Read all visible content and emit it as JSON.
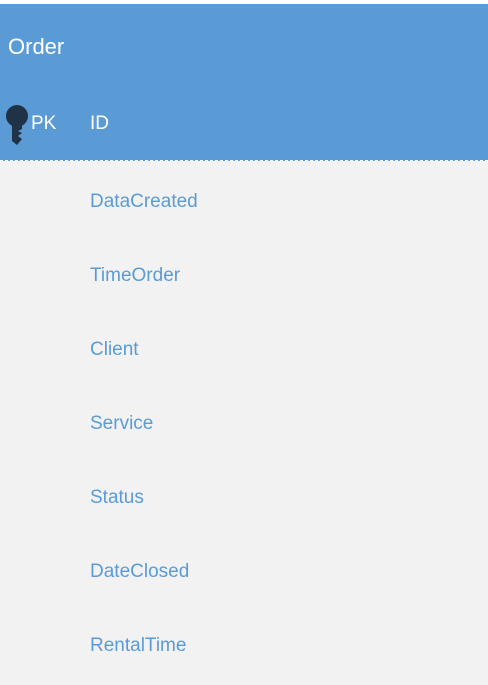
{
  "entity": {
    "name": "Order",
    "primary_key": {
      "marker": "PK",
      "icon": "key-icon",
      "field": "ID"
    },
    "fields": [
      "DataCreated",
      "TimeOrder",
      "Client",
      "Service",
      "Status",
      "DateClosed",
      "RentalTime"
    ],
    "colors": {
      "header": "#5b9bd5",
      "body": "#f2f2f2",
      "field_text": "#5b9bd5",
      "header_text": "#ffffff"
    }
  }
}
